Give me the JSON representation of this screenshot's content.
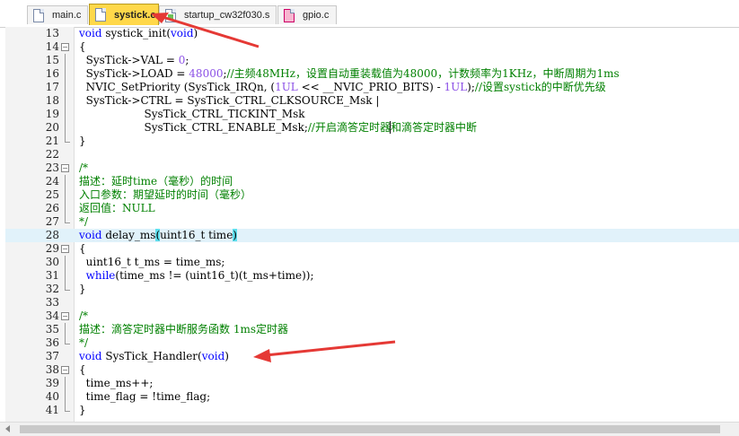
{
  "tabs": [
    {
      "label": "main.c",
      "icon": "c-file-icon",
      "active": false
    },
    {
      "label": "systick.c",
      "icon": "c-file-icon",
      "active": true
    },
    {
      "label": "startup_cw32f030.s",
      "icon": "asm-file-icon",
      "active": false
    },
    {
      "label": "gpio.c",
      "icon": "c-file-modified-icon",
      "active": false
    }
  ],
  "editor": {
    "lines": [
      {
        "n": "13",
        "fold": "none"
      },
      {
        "n": "14",
        "fold": "open"
      },
      {
        "n": "15",
        "fold": "line"
      },
      {
        "n": "16",
        "fold": "line"
      },
      {
        "n": "17",
        "fold": "line"
      },
      {
        "n": "18",
        "fold": "line"
      },
      {
        "n": "19",
        "fold": "line"
      },
      {
        "n": "20",
        "fold": "line"
      },
      {
        "n": "21",
        "fold": "end"
      },
      {
        "n": "22",
        "fold": "none"
      },
      {
        "n": "23",
        "fold": "open"
      },
      {
        "n": "24",
        "fold": "line"
      },
      {
        "n": "25",
        "fold": "line"
      },
      {
        "n": "26",
        "fold": "line"
      },
      {
        "n": "27",
        "fold": "end"
      },
      {
        "n": "28",
        "fold": "none",
        "highlight": true
      },
      {
        "n": "29",
        "fold": "open"
      },
      {
        "n": "30",
        "fold": "line"
      },
      {
        "n": "31",
        "fold": "line"
      },
      {
        "n": "32",
        "fold": "end"
      },
      {
        "n": "33",
        "fold": "none"
      },
      {
        "n": "34",
        "fold": "open"
      },
      {
        "n": "35",
        "fold": "line"
      },
      {
        "n": "36",
        "fold": "end"
      },
      {
        "n": "37",
        "fold": "none"
      },
      {
        "n": "38",
        "fold": "open"
      },
      {
        "n": "39",
        "fold": "line"
      },
      {
        "n": "40",
        "fold": "line"
      },
      {
        "n": "41",
        "fold": "end"
      }
    ],
    "code": {
      "l13": {
        "kw": "void",
        "t1": " systick_init(",
        "kw2": "void",
        "t2": ")"
      },
      "l14": "{",
      "l15": {
        "t1": "  SysTick->VAL = ",
        "num": "0",
        "t2": ";"
      },
      "l16": {
        "t1": "  SysTick->LOAD = ",
        "num": "48000",
        "t2": ";",
        "cm": "//主频48MHz，设置自动重装载值为48000，计数频率为1KHz，中断周期为1ms"
      },
      "l17": {
        "t1": "  NVIC_SetPriority (SysTick_IRQn, (",
        "num": "1UL",
        "t2": " << __NVIC_PRIO_BITS) - ",
        "num2": "1UL",
        "t3": ");",
        "cm": "//设置systick的中断优先级"
      },
      "l18": "  SysTick->CTRL = SysTick_CTRL_CLKSOURCE_Msk |",
      "l19": "                   SysTick_CTRL_TICKINT_Msk",
      "l20": {
        "t1": "                   SysTick_CTRL_ENABLE_Msk;",
        "cm": "//开启滴答定时器和滴答定时器中断"
      },
      "l21": "}",
      "l22": "",
      "l23": "/*",
      "l24": "描述：延时time（毫秒）的时间",
      "l25": "入口参数：期望延时的时间（毫秒）",
      "l26": "返回值：NULL",
      "l27": "*/",
      "l28": {
        "kw": "void",
        "t1": " delay_ms",
        "b1": "(",
        "t2": "uint16_t time",
        "b2": ")"
      },
      "l29": "{",
      "l30": "  uint16_t t_ms = time_ms;",
      "l31": {
        "kw": "  while",
        "t1": "(time_ms != (uint16_t)(t_ms+time));"
      },
      "l32": "}",
      "l33": "",
      "l34": "/*",
      "l35": "描述：滴答定时器中断服务函数 1ms定时器",
      "l36": "*/",
      "l37": {
        "kw": "void",
        "t1": " SysTick_Handler(",
        "kw2": "void",
        "t2": ")"
      },
      "l38": "{",
      "l39": "  time_ms++;",
      "l40": "  time_flag = !time_flag;",
      "l41": "}"
    }
  },
  "annotations": {
    "arrow_color": "#e53935"
  },
  "colors": {
    "keyword": "#0000ff",
    "comment": "#008000",
    "number": "#8b4fe6",
    "active_tab": "#ffd84a",
    "current_line": "#e1f2fa",
    "brace_match": "#5fe0ee"
  }
}
